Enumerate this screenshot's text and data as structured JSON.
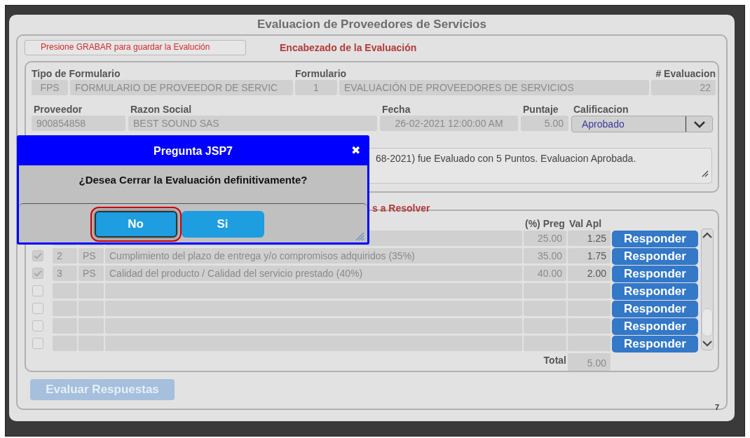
{
  "window": {
    "title": "Evaluacion de Proveedores de Servicios"
  },
  "notice": "Presione GRABAR para guardar la Evalución",
  "header_title": "Encabezado de la Evaluación",
  "header": {
    "row_1": [
      {
        "label": "Tipo de Formulario",
        "values": [
          "FPS",
          "FORMULARIO DE PROVEEDOR DE SERVIC"
        ]
      },
      {
        "label": "Formulario",
        "values": [
          "1",
          "EVALUACIÓN DE  PROVEEDORES DE SERVICIOS"
        ]
      },
      {
        "label": "# Evaluacion",
        "values": [
          "22"
        ]
      }
    ],
    "row_2": [
      {
        "label": "Proveedor",
        "value": "900854858"
      },
      {
        "label": "Razon Social",
        "value": "BEST SOUND SAS"
      },
      {
        "label": "Fecha",
        "value": "26-02-2021 12:00:00 AM"
      },
      {
        "label": "Puntaje",
        "value": "5.00"
      },
      {
        "label": "Calificacion",
        "value": "Aprobado",
        "kind": "select"
      }
    ],
    "observation": "68-2021) fue Evaluado con 5 Puntos. Evaluacion Aprobada."
  },
  "questions": {
    "title": "s a Resolver",
    "columns": [
      "(%) Preg",
      "Val Apl"
    ],
    "rows": [
      {
        "pct": "25.00",
        "value": "1.25",
        "button": "Responder"
      },
      {
        "checked": true,
        "number": "2",
        "type": "PS",
        "text": "Cumplimiento del plazo de entrega y/o compromisos adquiridos (35%)",
        "pct": "35.00",
        "value": "1.75",
        "button": "Responder"
      },
      {
        "checked": true,
        "number": "3",
        "type": "PS",
        "text": "Calidad del producto / Calidad del servicio prestado (40%)",
        "pct": "40.00",
        "value": "2.00",
        "button": "Responder"
      },
      {
        "checked": false,
        "button": "Responder"
      },
      {
        "checked": false,
        "button": "Responder"
      },
      {
        "checked": false,
        "button": "Responder"
      },
      {
        "checked": false,
        "button": "Responder"
      }
    ],
    "total_label": "Total",
    "total": "5.00"
  },
  "evaluate_button": {
    "label": "Evaluar Respuestas",
    "disabled": true
  },
  "page_number": "7",
  "dialog": {
    "title": "Pregunta JSP7",
    "close": "✖",
    "message": "¿Desea Cerrar la Evaluación definitivamente?",
    "buttons": [
      {
        "label": "No",
        "selected": true
      },
      {
        "label": "Si",
        "selected": false
      }
    ]
  }
}
